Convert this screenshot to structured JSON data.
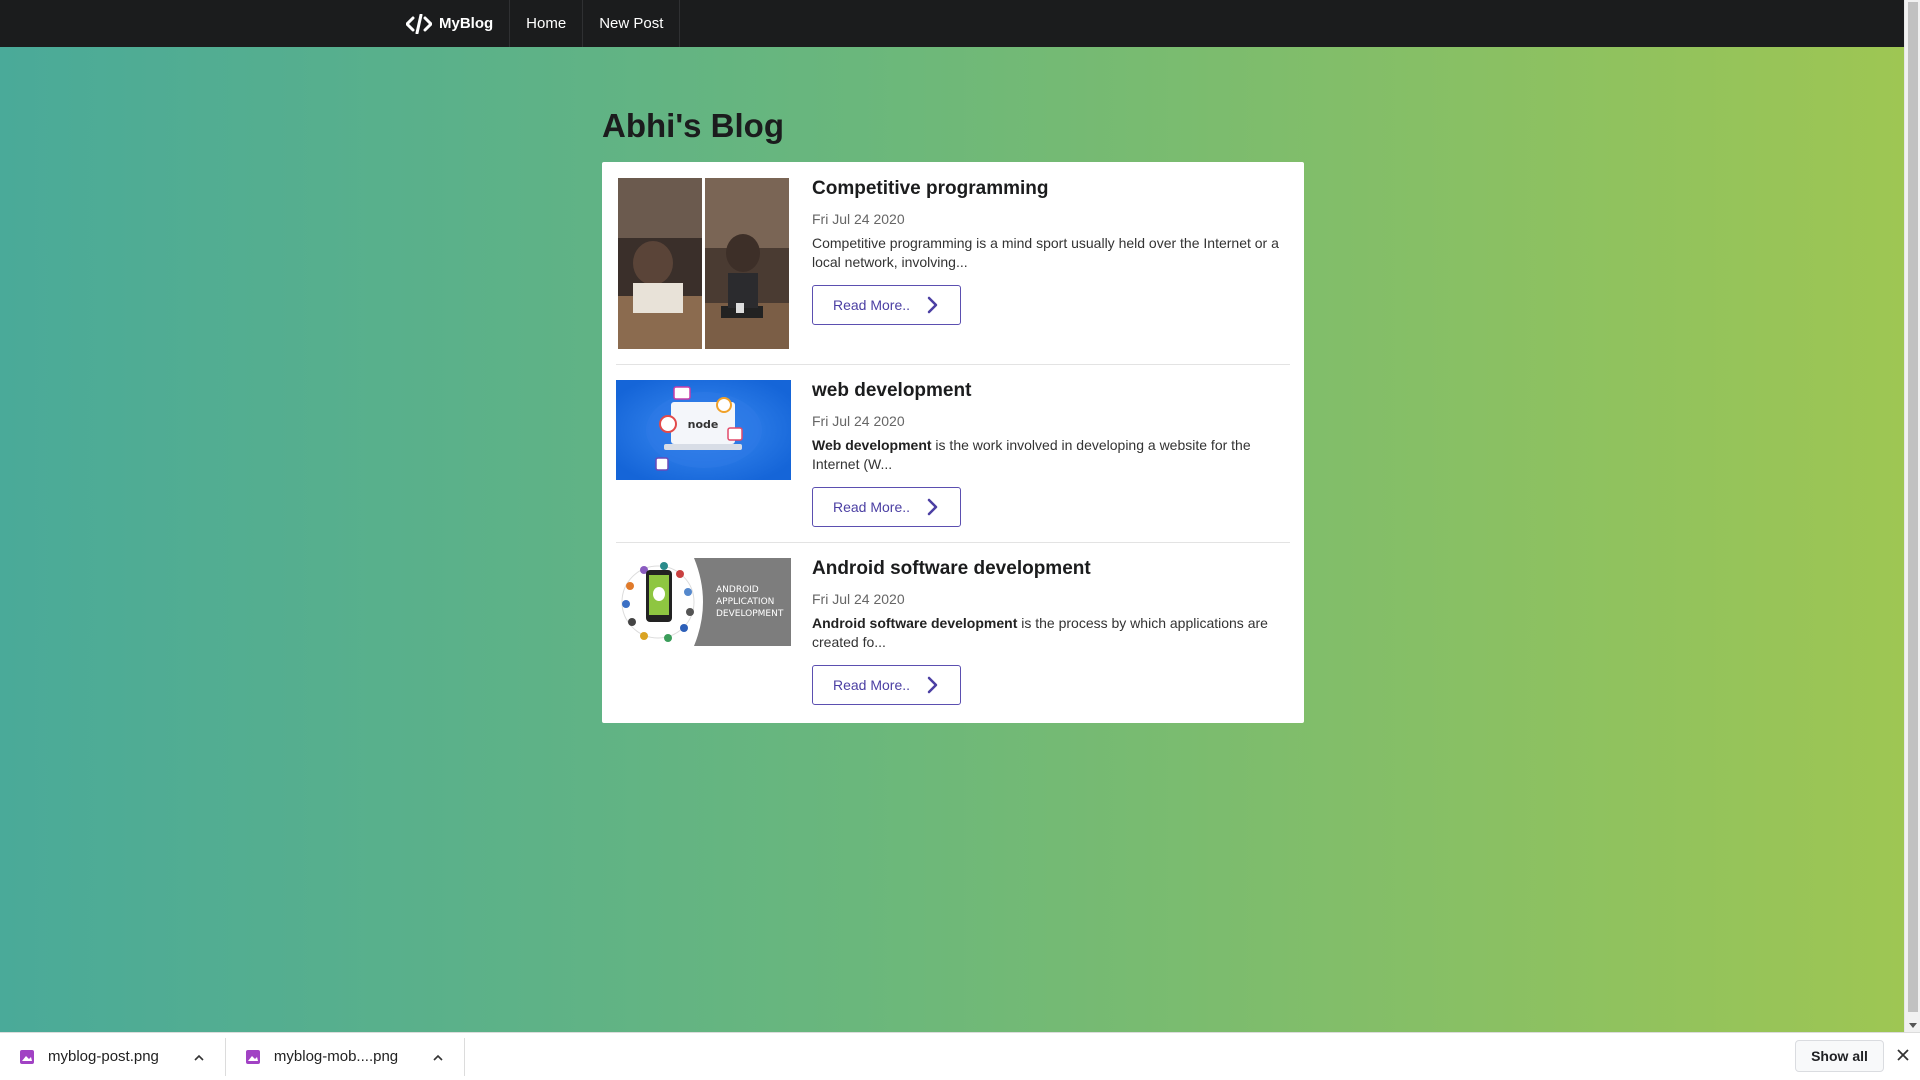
{
  "nav": {
    "brand": "MyBlog",
    "links": [
      "Home",
      "New Post"
    ]
  },
  "page": {
    "title": "Abhi's Blog"
  },
  "posts": [
    {
      "title": "Competitive programming",
      "date": "Fri Jul 24 2020",
      "excerpt_bold": "",
      "excerpt": "Competitive programming is a mind sport usually held over the Internet or a local network, involving...",
      "read_more": "Read More.."
    },
    {
      "title": "web development",
      "date": "Fri Jul 24 2020",
      "excerpt_bold": "Web development",
      "excerpt": " is the work involved in developing a website for the Internet (W...",
      "read_more": "Read More.."
    },
    {
      "title": "Android software development",
      "date": "Fri Jul 24 2020",
      "excerpt_bold": "Android software development",
      "excerpt": " is the process by which applications are created fo...",
      "read_more": "Read More.."
    }
  ],
  "thumb_text": {
    "node": "node",
    "android_l1": "ANDROID",
    "android_l2": "APPLICATION",
    "android_l3": "DEVELOPMENT"
  },
  "downloads": {
    "items": [
      "myblog-post.png",
      "myblog-mob....png"
    ],
    "show_all": "Show all"
  },
  "colors": {
    "nav_bg": "#1b1c1d",
    "gradient_start": "#4aaa99",
    "gradient_end": "#9ec653",
    "button_accent": "#5b4fb0"
  }
}
